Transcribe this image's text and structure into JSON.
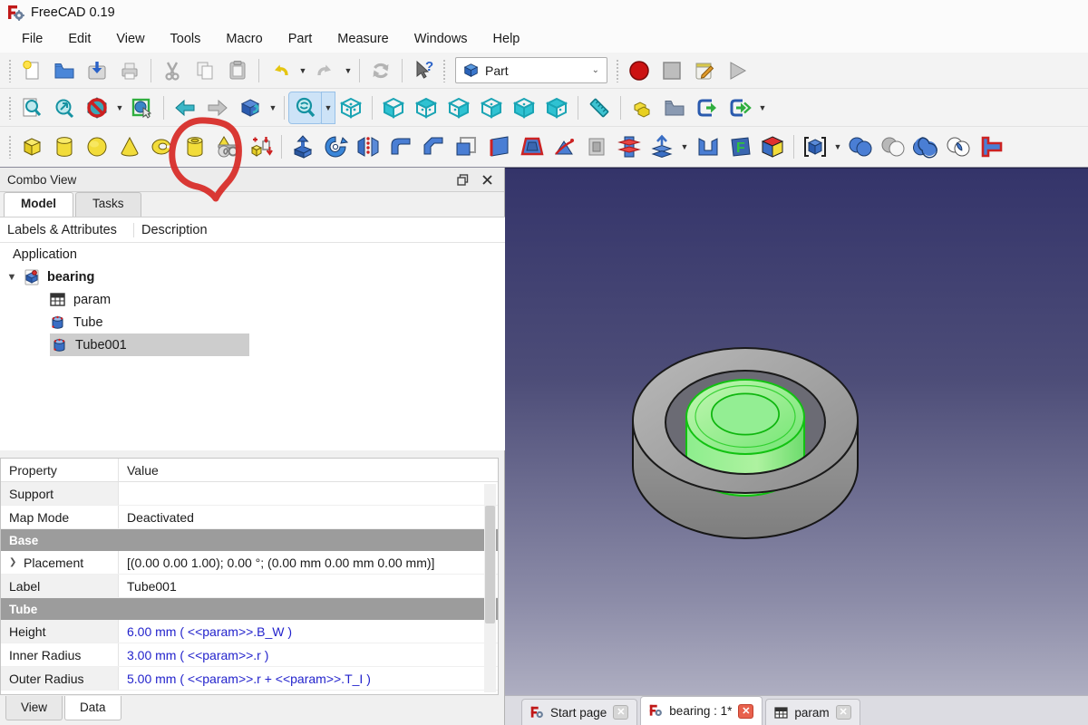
{
  "window": {
    "title": "FreeCAD 0.19"
  },
  "menu": {
    "items": [
      "File",
      "Edit",
      "View",
      "Tools",
      "Macro",
      "Part",
      "Measure",
      "Windows",
      "Help"
    ]
  },
  "toolbar": {
    "workbench_selector": "Part"
  },
  "combo_view": {
    "title": "Combo View",
    "tabs": {
      "model": "Model",
      "tasks": "Tasks"
    },
    "tree": {
      "columns": [
        "Labels & Attributes",
        "Description"
      ],
      "root": "Application",
      "document": "bearing",
      "items": [
        {
          "label": "param",
          "icon": "spreadsheet-icon"
        },
        {
          "label": "Tube",
          "icon": "tube-icon"
        },
        {
          "label": "Tube001",
          "icon": "tube-icon",
          "selected": true
        }
      ]
    }
  },
  "properties": {
    "columns": [
      "Property",
      "Value"
    ],
    "rows": [
      {
        "name": "Support",
        "value": ""
      },
      {
        "name": "Map Mode",
        "value": "Deactivated"
      },
      {
        "name": "Base",
        "section": true
      },
      {
        "name": "Placement",
        "value": "[(0.00 0.00 1.00); 0.00 °; (0.00 mm  0.00 mm  0.00 mm)]",
        "expandable": true
      },
      {
        "name": "Label",
        "value": "Tube001"
      },
      {
        "name": "Tube",
        "section": true
      },
      {
        "name": "Height",
        "value": "6.00 mm  ( <<param>>.B_W )",
        "formula": true
      },
      {
        "name": "Inner Radius",
        "value": "3.00 mm  ( <<param>>.r )",
        "formula": true
      },
      {
        "name": "Outer Radius",
        "value": "5.00 mm  ( <<param>>.r + <<param>>.T_I )",
        "formula": true
      }
    ],
    "bottom_tabs": {
      "view": "View",
      "data": "Data"
    }
  },
  "viewport": {
    "document_tabs": [
      {
        "label": "Start page"
      },
      {
        "label": "bearing : 1*"
      },
      {
        "label": "param"
      }
    ],
    "background_top": "#34346a",
    "background_bottom": "#aeaec1",
    "model": {
      "ring_color": "#9a9a9a",
      "selection_color": "#7ae57a"
    }
  },
  "annotation": {
    "color": "#d7302c",
    "meaning": "hand-drawn circle around Tube tool"
  }
}
